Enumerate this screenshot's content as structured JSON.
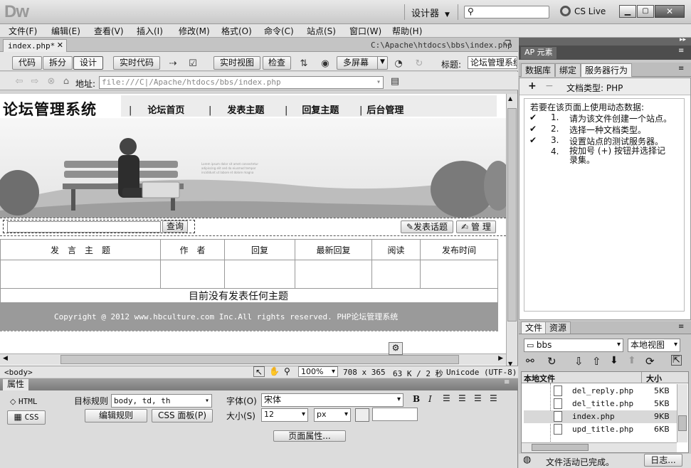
{
  "app": {
    "logo": "Dw",
    "workspace": "设计器",
    "search_placeholder": "",
    "cslive": "CS Live"
  },
  "menu": [
    "文件(F)",
    "编辑(E)",
    "查看(V)",
    "插入(I)",
    "修改(M)",
    "格式(O)",
    "命令(C)",
    "站点(S)",
    "窗口(W)",
    "帮助(H)"
  ],
  "document": {
    "tab": "index.php*",
    "path": "C:\\Apache\\htdocs\\bbs\\index.php",
    "views": {
      "code": "代码",
      "split": "拆分",
      "design": "设计",
      "live_code": "实时代码",
      "live_view": "实时视图",
      "inspect": "检查",
      "multiscreen": "多屏幕"
    },
    "title_label": "标题:",
    "title_value": "论坛管理系统",
    "address_label": "地址:",
    "address": "file:///C|/Apache/htdocs/bbs/index.php"
  },
  "page": {
    "site_title": "论坛管理系统",
    "nav": [
      "论坛首页",
      "发表主题",
      "回复主题",
      "后台管理"
    ],
    "search_button": "查询",
    "post_button": "发表话题",
    "manage_button": "管 理",
    "table_headers": [
      "发　言　主　题",
      "作　者",
      "回复",
      "最新回复",
      "阅读",
      "发布时间"
    ],
    "empty_message": "目前没有发表任何主题",
    "copyright": "Copyright @ 2012 www.hbculture.com Inc.All rights reserved. PHP论坛管理系统"
  },
  "status": {
    "tag": "<body>",
    "zoom": "100%",
    "size": "708 x 365",
    "weight": "63 K / 2 秒",
    "encoding": "Unicode (UTF-8)"
  },
  "properties": {
    "header": "属性",
    "html": "HTML",
    "css": "CSS",
    "target_rule_label": "目标规则",
    "target_rule": "body, td, th",
    "edit_rule": "编辑规则",
    "css_panel": "CSS 面板(P)",
    "font_label": "字体(O)",
    "font_value": "宋体",
    "size_label": "大小(S)",
    "size_value": "12",
    "unit": "px",
    "page_props": "页面属性..."
  },
  "right": {
    "ap_tab": "AP 元素",
    "tabs": [
      "数据库",
      "绑定",
      "服务器行为"
    ],
    "doc_type": "文档类型: PHP",
    "intro": "若要在该页面上使用动态数据:",
    "steps": [
      {
        "check": "✔",
        "num": "1.",
        "text": "请为该文件创建一个站点。"
      },
      {
        "check": "✔",
        "num": "2.",
        "text": "选择一种文档类型。"
      },
      {
        "check": "✔",
        "num": "3.",
        "text": "设置站点的测试服务器。"
      },
      {
        "check": "",
        "num": "4.",
        "text": "按加号 (+) 按钮并选择记录集。"
      }
    ],
    "files_tabs": [
      "文件",
      "资源"
    ],
    "site": "bbs",
    "view": "本地视图",
    "col_local": "本地文件",
    "col_size": "大小",
    "files": [
      {
        "name": "del_reply.php",
        "size": "5KB"
      },
      {
        "name": "del_title.php",
        "size": "5KB"
      },
      {
        "name": "index.php",
        "size": "9KB"
      },
      {
        "name": "upd_title.php",
        "size": "6KB"
      }
    ],
    "activity": "文件活动已完成。",
    "log_button": "日志..."
  }
}
